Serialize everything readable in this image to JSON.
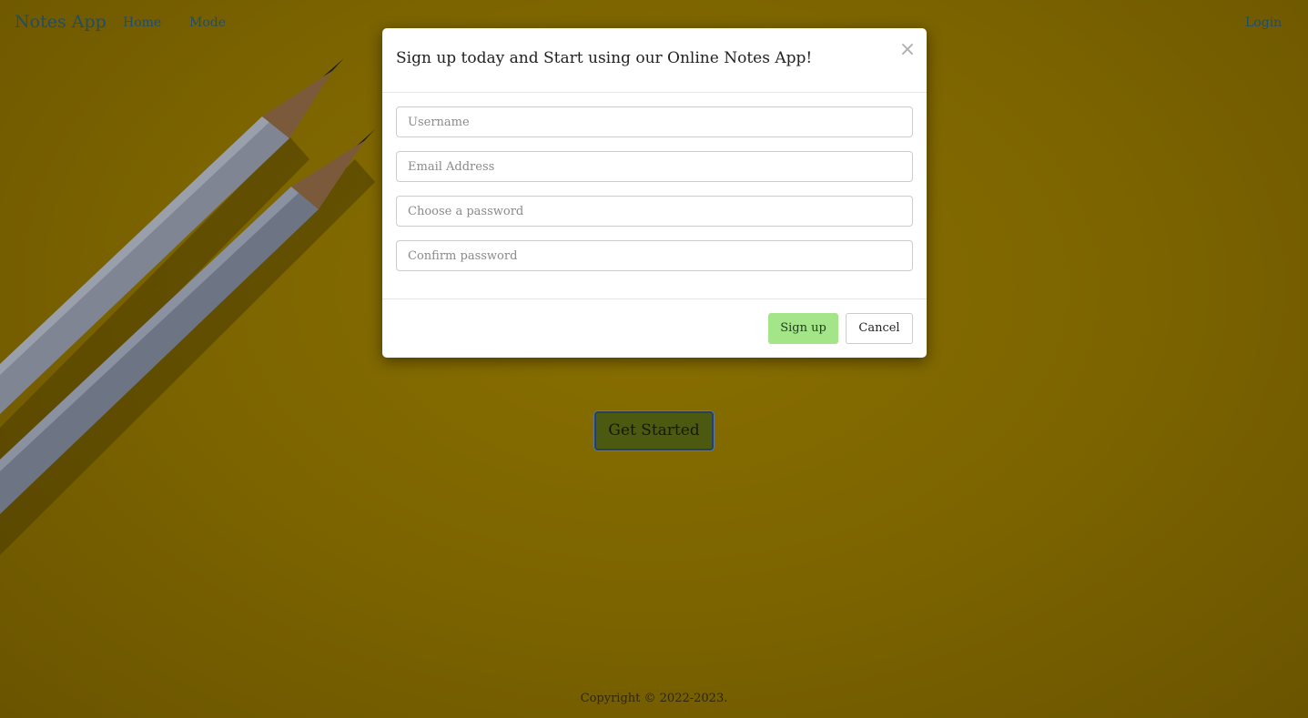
{
  "navbar": {
    "brand": "Notes App",
    "home": "Home",
    "mode": "Mode",
    "login": "Login"
  },
  "hero": {
    "get_started": "Get Started"
  },
  "footer": {
    "copyright": "Copyright © 2022-2023."
  },
  "modal": {
    "title": "Sign up today and Start using our Online Notes App!",
    "close_symbol": "×",
    "fields": [
      {
        "placeholder": "Username",
        "value": ""
      },
      {
        "placeholder": "Email Address",
        "value": ""
      },
      {
        "placeholder": "Choose a password",
        "value": ""
      },
      {
        "placeholder": "Confirm password",
        "value": ""
      }
    ],
    "signup_label": "Sign up",
    "cancel_label": "Cancel"
  },
  "colors": {
    "background": "#7b6300",
    "link": "#1f4e6b",
    "signup_button": "#a4e58a",
    "get_started_button": "#4b5a10"
  },
  "icons": {
    "close": "close-icon",
    "background_image": "pencils-image"
  }
}
